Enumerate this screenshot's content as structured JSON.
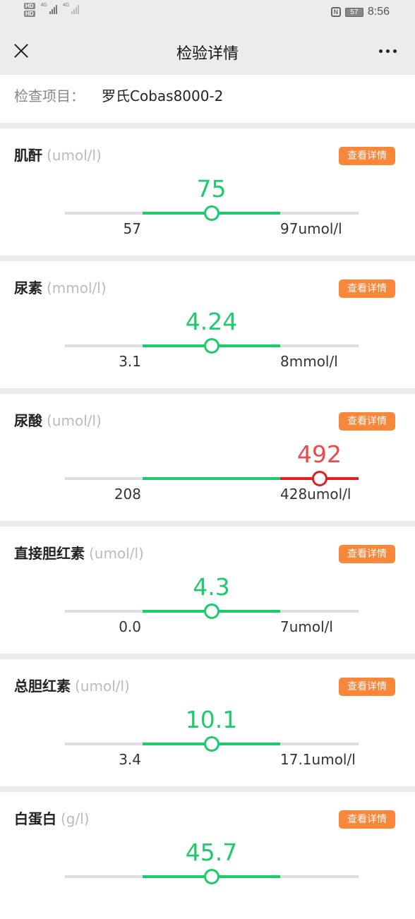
{
  "statusbar": {
    "hd1": "HD",
    "hd2": "HD",
    "net1": "4G",
    "net2": "4G",
    "battery": "57",
    "time": "8:56"
  },
  "nav": {
    "title": "检验详情",
    "close_icon": "close-icon",
    "more_icon": "more-icon"
  },
  "project": {
    "label": "检查项目：",
    "value": "罗氏Cobas8000-2"
  },
  "detail_button_label": "查看详情",
  "colors": {
    "normal": "#1ecb6b",
    "abnormal": "#e02020",
    "button": "#f7873a"
  },
  "tests": [
    {
      "name": "肌酐",
      "unit": "(umol/l)",
      "value": "75",
      "low": "57",
      "high": "97umol/l",
      "status": "normal",
      "marker_position": 0.5
    },
    {
      "name": "尿素",
      "unit": "(mmol/l)",
      "value": "4.24",
      "low": "3.1",
      "high": "8mmol/l",
      "status": "normal",
      "marker_position": 0.5
    },
    {
      "name": "尿酸",
      "unit": "(umol/l)",
      "value": "492",
      "low": "208",
      "high": "428umol/l",
      "status": "high",
      "marker_position": 0.9
    },
    {
      "name": "直接胆红素",
      "unit": "(umol/l)",
      "value": "4.3",
      "low": "0.0",
      "high": "7umol/l",
      "status": "normal",
      "marker_position": 0.5
    },
    {
      "name": "总胆红素",
      "unit": "(umol/l)",
      "value": "10.1",
      "low": "3.4",
      "high": "17.1umol/l",
      "status": "normal",
      "marker_position": 0.5
    },
    {
      "name": "白蛋白",
      "unit": "(g/l)",
      "value": "45.7",
      "low": "",
      "high": "",
      "status": "normal",
      "marker_position": 0.5
    }
  ]
}
